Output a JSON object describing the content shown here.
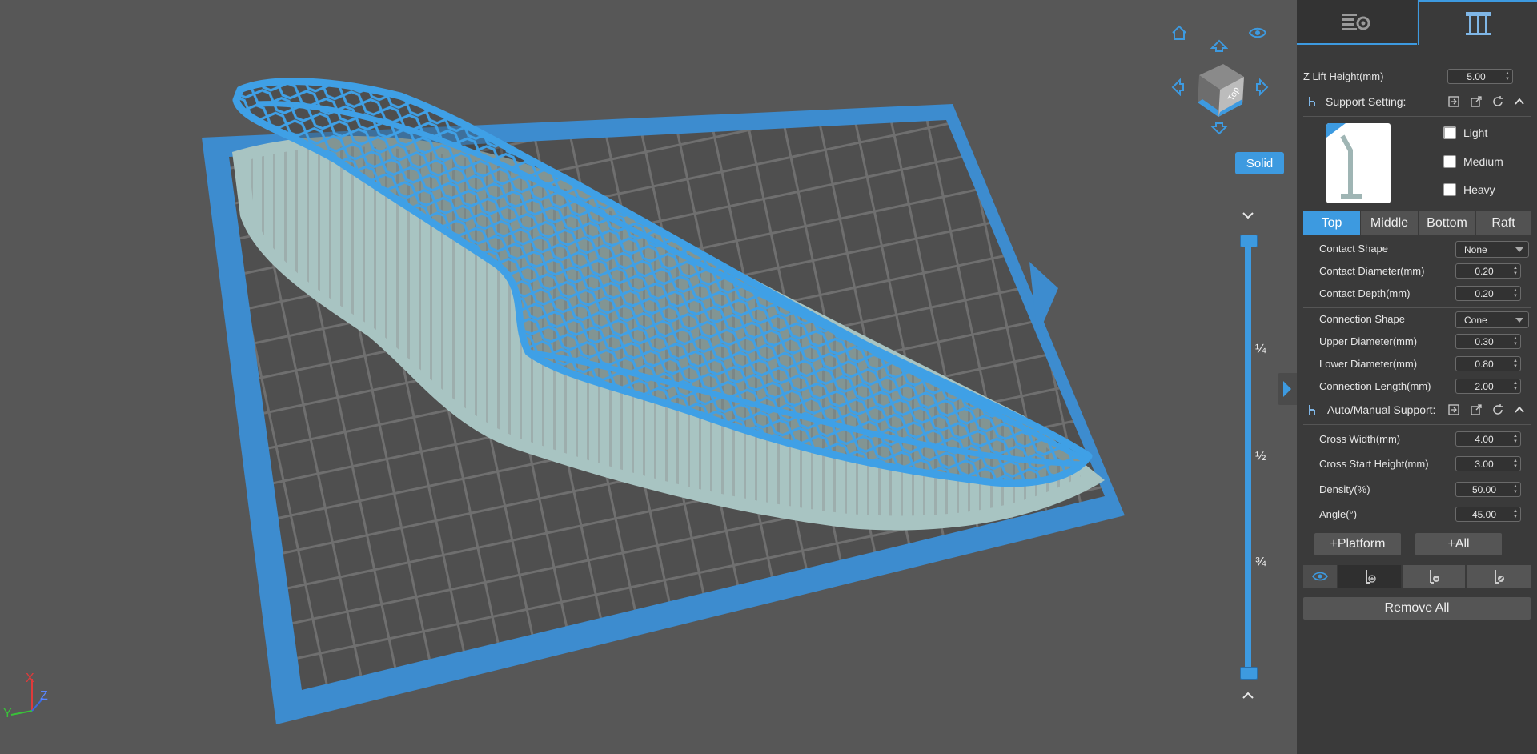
{
  "viewport": {
    "view_cube_face": "Top",
    "render_mode": "Solid",
    "slider_fractions": [
      "¼",
      "½",
      "¾"
    ],
    "icons": [
      "home-icon",
      "eye-icon",
      "arrow-up-icon",
      "arrow-left-icon",
      "arrow-right-icon",
      "arrow-down-icon",
      "chevron-down-icon",
      "chevron-up-icon",
      "expand-panel-icon"
    ],
    "axes": {
      "x": "X",
      "y": "Y",
      "z": "Z"
    },
    "colors": {
      "model": "#3d9ae0",
      "support": "#a8c4c2",
      "platform": "#3d8ccf",
      "background": "#575757"
    }
  },
  "panel": {
    "tabs": [
      {
        "name": "print-settings",
        "icon": "settings-icon"
      },
      {
        "name": "support",
        "icon": "support-icon",
        "active": true
      }
    ],
    "z_lift": {
      "label": "Z Lift Height(mm)",
      "value": "5.00"
    },
    "support_setting": {
      "title": "Support Setting:",
      "icons": [
        "import-icon",
        "export-icon",
        "refresh-icon",
        "collapse-icon"
      ],
      "presets": [
        {
          "label": "Light",
          "checked": true
        },
        {
          "label": "Medium",
          "checked": false
        },
        {
          "label": "Heavy",
          "checked": false
        }
      ]
    },
    "segments": [
      "Top",
      "Middle",
      "Bottom",
      "Raft"
    ],
    "active_segment": "Top",
    "contact": {
      "shape_label": "Contact Shape",
      "shape_value": "None",
      "diameter_label": "Contact Diameter(mm)",
      "diameter_value": "0.20",
      "depth_label": "Contact Depth(mm)",
      "depth_value": "0.20"
    },
    "connection": {
      "shape_label": "Connection Shape",
      "shape_value": "Cone",
      "upper_label": "Upper Diameter(mm)",
      "upper_value": "0.30",
      "lower_label": "Lower Diameter(mm)",
      "lower_value": "0.80",
      "length_label": "Connection Length(mm)",
      "length_value": "2.00"
    },
    "auto_manual": {
      "title": "Auto/Manual Support:",
      "cross_width_label": "Cross Width(mm)",
      "cross_width_value": "4.00",
      "cross_start_label": "Cross Start Height(mm)",
      "cross_start_value": "3.00",
      "density_label": "Density(%)",
      "density_value": "50.00",
      "angle_label": "Angle(°)",
      "angle_value": "45.00"
    },
    "buttons": {
      "platform": "+Platform",
      "all": "+All",
      "remove_all": "Remove All"
    },
    "tool_icons": [
      "visibility-icon",
      "add-support-icon",
      "remove-support-icon",
      "edit-support-icon"
    ]
  }
}
